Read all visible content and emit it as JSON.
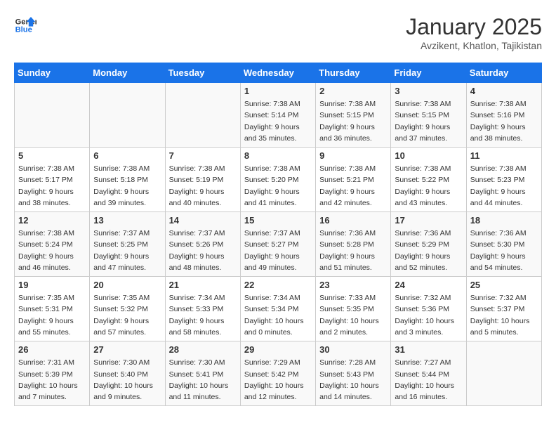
{
  "logo": {
    "line1": "General",
    "line2": "Blue"
  },
  "title": "January 2025",
  "subtitle": "Avzikent, Khatlon, Tajikistan",
  "headers": [
    "Sunday",
    "Monday",
    "Tuesday",
    "Wednesday",
    "Thursday",
    "Friday",
    "Saturday"
  ],
  "weeks": [
    [
      {
        "day": "",
        "info": ""
      },
      {
        "day": "",
        "info": ""
      },
      {
        "day": "",
        "info": ""
      },
      {
        "day": "1",
        "info": "Sunrise: 7:38 AM\nSunset: 5:14 PM\nDaylight: 9 hours\nand 35 minutes."
      },
      {
        "day": "2",
        "info": "Sunrise: 7:38 AM\nSunset: 5:15 PM\nDaylight: 9 hours\nand 36 minutes."
      },
      {
        "day": "3",
        "info": "Sunrise: 7:38 AM\nSunset: 5:15 PM\nDaylight: 9 hours\nand 37 minutes."
      },
      {
        "day": "4",
        "info": "Sunrise: 7:38 AM\nSunset: 5:16 PM\nDaylight: 9 hours\nand 38 minutes."
      }
    ],
    [
      {
        "day": "5",
        "info": "Sunrise: 7:38 AM\nSunset: 5:17 PM\nDaylight: 9 hours\nand 38 minutes."
      },
      {
        "day": "6",
        "info": "Sunrise: 7:38 AM\nSunset: 5:18 PM\nDaylight: 9 hours\nand 39 minutes."
      },
      {
        "day": "7",
        "info": "Sunrise: 7:38 AM\nSunset: 5:19 PM\nDaylight: 9 hours\nand 40 minutes."
      },
      {
        "day": "8",
        "info": "Sunrise: 7:38 AM\nSunset: 5:20 PM\nDaylight: 9 hours\nand 41 minutes."
      },
      {
        "day": "9",
        "info": "Sunrise: 7:38 AM\nSunset: 5:21 PM\nDaylight: 9 hours\nand 42 minutes."
      },
      {
        "day": "10",
        "info": "Sunrise: 7:38 AM\nSunset: 5:22 PM\nDaylight: 9 hours\nand 43 minutes."
      },
      {
        "day": "11",
        "info": "Sunrise: 7:38 AM\nSunset: 5:23 PM\nDaylight: 9 hours\nand 44 minutes."
      }
    ],
    [
      {
        "day": "12",
        "info": "Sunrise: 7:38 AM\nSunset: 5:24 PM\nDaylight: 9 hours\nand 46 minutes."
      },
      {
        "day": "13",
        "info": "Sunrise: 7:37 AM\nSunset: 5:25 PM\nDaylight: 9 hours\nand 47 minutes."
      },
      {
        "day": "14",
        "info": "Sunrise: 7:37 AM\nSunset: 5:26 PM\nDaylight: 9 hours\nand 48 minutes."
      },
      {
        "day": "15",
        "info": "Sunrise: 7:37 AM\nSunset: 5:27 PM\nDaylight: 9 hours\nand 49 minutes."
      },
      {
        "day": "16",
        "info": "Sunrise: 7:36 AM\nSunset: 5:28 PM\nDaylight: 9 hours\nand 51 minutes."
      },
      {
        "day": "17",
        "info": "Sunrise: 7:36 AM\nSunset: 5:29 PM\nDaylight: 9 hours\nand 52 minutes."
      },
      {
        "day": "18",
        "info": "Sunrise: 7:36 AM\nSunset: 5:30 PM\nDaylight: 9 hours\nand 54 minutes."
      }
    ],
    [
      {
        "day": "19",
        "info": "Sunrise: 7:35 AM\nSunset: 5:31 PM\nDaylight: 9 hours\nand 55 minutes."
      },
      {
        "day": "20",
        "info": "Sunrise: 7:35 AM\nSunset: 5:32 PM\nDaylight: 9 hours\nand 57 minutes."
      },
      {
        "day": "21",
        "info": "Sunrise: 7:34 AM\nSunset: 5:33 PM\nDaylight: 9 hours\nand 58 minutes."
      },
      {
        "day": "22",
        "info": "Sunrise: 7:34 AM\nSunset: 5:34 PM\nDaylight: 10 hours\nand 0 minutes."
      },
      {
        "day": "23",
        "info": "Sunrise: 7:33 AM\nSunset: 5:35 PM\nDaylight: 10 hours\nand 2 minutes."
      },
      {
        "day": "24",
        "info": "Sunrise: 7:32 AM\nSunset: 5:36 PM\nDaylight: 10 hours\nand 3 minutes."
      },
      {
        "day": "25",
        "info": "Sunrise: 7:32 AM\nSunset: 5:37 PM\nDaylight: 10 hours\nand 5 minutes."
      }
    ],
    [
      {
        "day": "26",
        "info": "Sunrise: 7:31 AM\nSunset: 5:39 PM\nDaylight: 10 hours\nand 7 minutes."
      },
      {
        "day": "27",
        "info": "Sunrise: 7:30 AM\nSunset: 5:40 PM\nDaylight: 10 hours\nand 9 minutes."
      },
      {
        "day": "28",
        "info": "Sunrise: 7:30 AM\nSunset: 5:41 PM\nDaylight: 10 hours\nand 11 minutes."
      },
      {
        "day": "29",
        "info": "Sunrise: 7:29 AM\nSunset: 5:42 PM\nDaylight: 10 hours\nand 12 minutes."
      },
      {
        "day": "30",
        "info": "Sunrise: 7:28 AM\nSunset: 5:43 PM\nDaylight: 10 hours\nand 14 minutes."
      },
      {
        "day": "31",
        "info": "Sunrise: 7:27 AM\nSunset: 5:44 PM\nDaylight: 10 hours\nand 16 minutes."
      },
      {
        "day": "",
        "info": ""
      }
    ]
  ]
}
